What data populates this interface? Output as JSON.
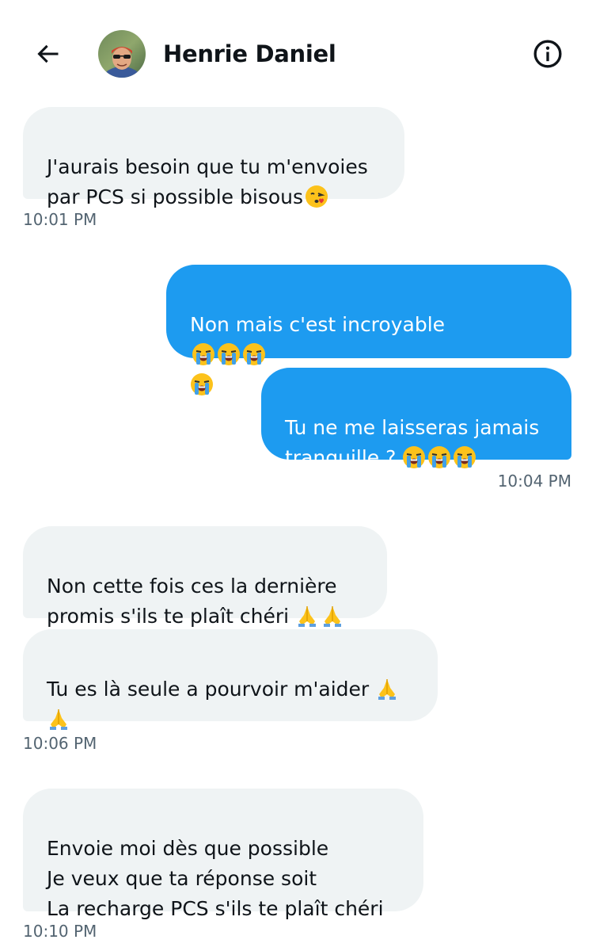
{
  "header": {
    "contact_name": "Henrie Daniel",
    "back_icon": "arrow-left-icon",
    "info_icon": "info-circle-icon"
  },
  "messages": [
    {
      "direction": "in",
      "text": "J'aurais besoin que tu m'envoies\npar PCS si possible bisous",
      "emoji": [
        "kissing-heart"
      ]
    },
    {
      "direction": "out",
      "text": "Non mais c'est incroyable",
      "emoji": [
        "loudly-crying",
        "loudly-crying",
        "loudly-crying",
        "loudly-crying"
      ]
    },
    {
      "direction": "out",
      "text": "Tu ne me laisseras jamais\ntranquille ?",
      "emoji": [
        "loudly-crying",
        "loudly-crying",
        "loudly-crying"
      ]
    },
    {
      "direction": "in",
      "text": "Non cette fois ces la dernière\npromis s'ils te plaît chéri",
      "emoji": [
        "folded-hands",
        "folded-hands"
      ]
    },
    {
      "direction": "in",
      "text": "Tu es là seule a pourvoir m'aider",
      "emoji": [
        "folded-hands",
        "folded-hands"
      ]
    },
    {
      "direction": "in",
      "text": "Envoie moi dès que possible\nJe veux que ta réponse soit\nLa recharge PCS s'ils te plaît chéri",
      "emoji": []
    }
  ],
  "timestamps": [
    "10:01 PM",
    "10:04 PM",
    "10:06 PM",
    "10:10 PM"
  ],
  "colors": {
    "incoming_bubble": "#eff3f4",
    "outgoing_bubble": "#1d9bf0",
    "timestamp": "#536471",
    "text": "#0f1419"
  }
}
